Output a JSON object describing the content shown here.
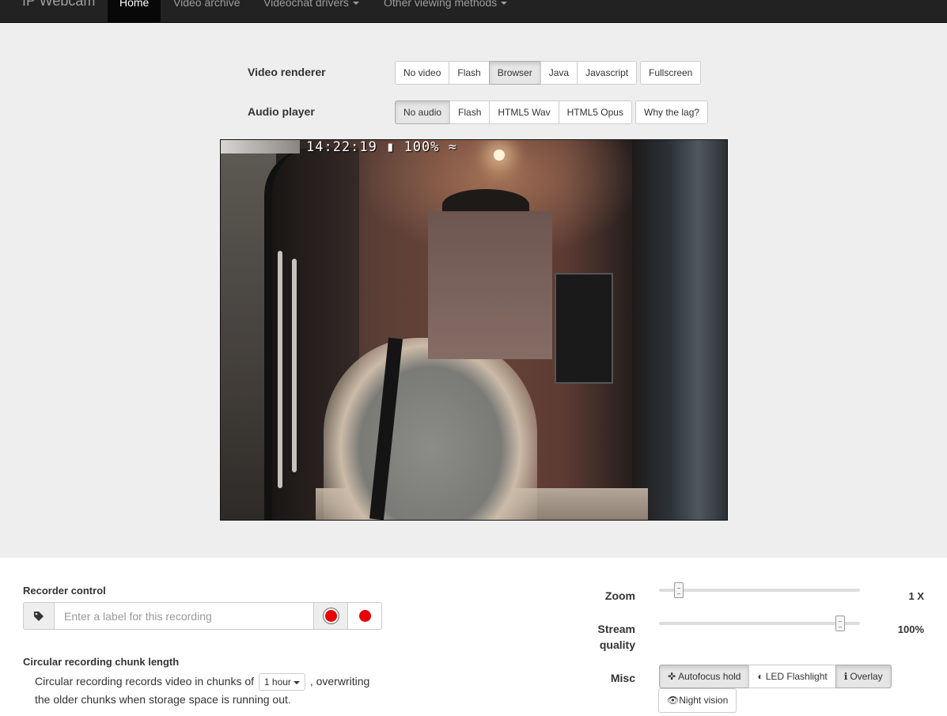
{
  "navbar": {
    "brand": "IP Webcam",
    "items": [
      {
        "label": "Home",
        "active": true
      },
      {
        "label": "Video archive"
      },
      {
        "label": "Videochat drivers",
        "dropdown": true
      },
      {
        "label": "Other viewing methods",
        "dropdown": true
      }
    ]
  },
  "renderer": {
    "label": "Video renderer",
    "options": [
      "No video",
      "Flash",
      "Browser",
      "Java",
      "Javascript"
    ],
    "selected": "Browser",
    "fullscreen": "Fullscreen"
  },
  "audio": {
    "label": "Audio player",
    "options": [
      "No audio",
      "Flash",
      "HTML5 Wav",
      "HTML5 Opus"
    ],
    "selected": "No audio",
    "lag": "Why the lag?"
  },
  "video": {
    "overlay_text": "14:22:19 ▮ 100% ≈"
  },
  "recorder": {
    "title": "Recorder control",
    "placeholder": "Enter a label for this recording",
    "tag_icon": "tag-icon",
    "record_icon": "record-icon"
  },
  "chunk": {
    "title": "Circular recording chunk length",
    "text_before": "Circular recording records video in chunks of",
    "selected": "1 hour",
    "text_after": ", overwriting the older chunks when storage space is running out."
  },
  "zoom": {
    "label": "Zoom",
    "value": "1 X",
    "level": 0.08
  },
  "quality": {
    "label": "Stream quality",
    "value": "100%",
    "level": 0.92
  },
  "misc": {
    "label": "Misc",
    "buttons": [
      {
        "icon": "crosshair-icon",
        "glyph": "✜",
        "label": "Autofocus hold",
        "active": true
      },
      {
        "icon": "half-circle-icon",
        "glyph": "◐",
        "label": "LED Flashlight",
        "active": false
      },
      {
        "icon": "info-icon",
        "glyph": "ℹ",
        "label": "Overlay",
        "active": true
      }
    ],
    "night": {
      "icon": "eye-icon",
      "glyph": "👁",
      "label": "Night vision"
    }
  },
  "colors": {
    "navbar_bg": "#222222",
    "panel_bg": "#eeeeee",
    "record_red": "#e80000"
  }
}
